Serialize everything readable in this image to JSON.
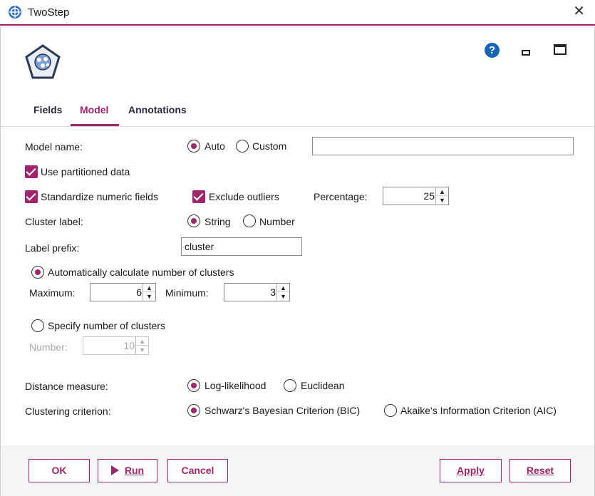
{
  "window": {
    "title": "TwoStep",
    "icon": "twostep-node-icon",
    "close_icon": "close-icon"
  },
  "header": {
    "icons": [
      "twostep-node-icon",
      "help-icon",
      "minimize-icon",
      "maximize-icon"
    ],
    "help_glyph": "?"
  },
  "tabs": [
    {
      "label": "Fields",
      "active": false
    },
    {
      "label": "Model",
      "active": true
    },
    {
      "label": "Annotations",
      "active": false
    }
  ],
  "model": {
    "model_name_label": "Model name:",
    "auto_label": "Auto",
    "custom_label": "Custom",
    "custom_value": "",
    "name_mode": "Auto",
    "use_partitioned_label": "Use partitioned data",
    "use_partitioned_checked": true,
    "standardize_label": "Standardize numeric fields",
    "standardize_checked": true,
    "exclude_outliers_label": "Exclude outliers",
    "exclude_outliers_checked": true,
    "percentage_label": "Percentage:",
    "percentage_value": "25",
    "cluster_label_label": "Cluster label:",
    "string_label": "String",
    "number_label": "Number",
    "cluster_label_mode": "String",
    "label_prefix_label": "Label prefix:",
    "label_prefix_value": "cluster",
    "auto_clusters_label": "Automatically calculate number of clusters",
    "maximum_label": "Maximum:",
    "maximum_value": "6",
    "minimum_label": "Minimum:",
    "minimum_value": "3",
    "specify_clusters_label": "Specify number of clusters",
    "number_field_label": "Number:",
    "number_field_value": "10",
    "distance_label": "Distance measure:",
    "loglik_label": "Log-likelihood",
    "euclidean_label": "Euclidean",
    "distance_mode": "Log-likelihood",
    "criterion_label": "Clustering criterion:",
    "bic_label": "Schwarz's Bayesian Criterion (BIC)",
    "aic_label": "Akaike's Information Criterion (AIC)",
    "criterion_mode": "BIC"
  },
  "footer": {
    "ok_label": "OK",
    "run_label": "Run",
    "cancel_label": "Cancel",
    "apply_label": "Apply",
    "reset_label": "Reset"
  },
  "colors": {
    "accent": "#a0256a",
    "help_blue": "#1763b5",
    "footer_bg": "#f5f5f8"
  }
}
